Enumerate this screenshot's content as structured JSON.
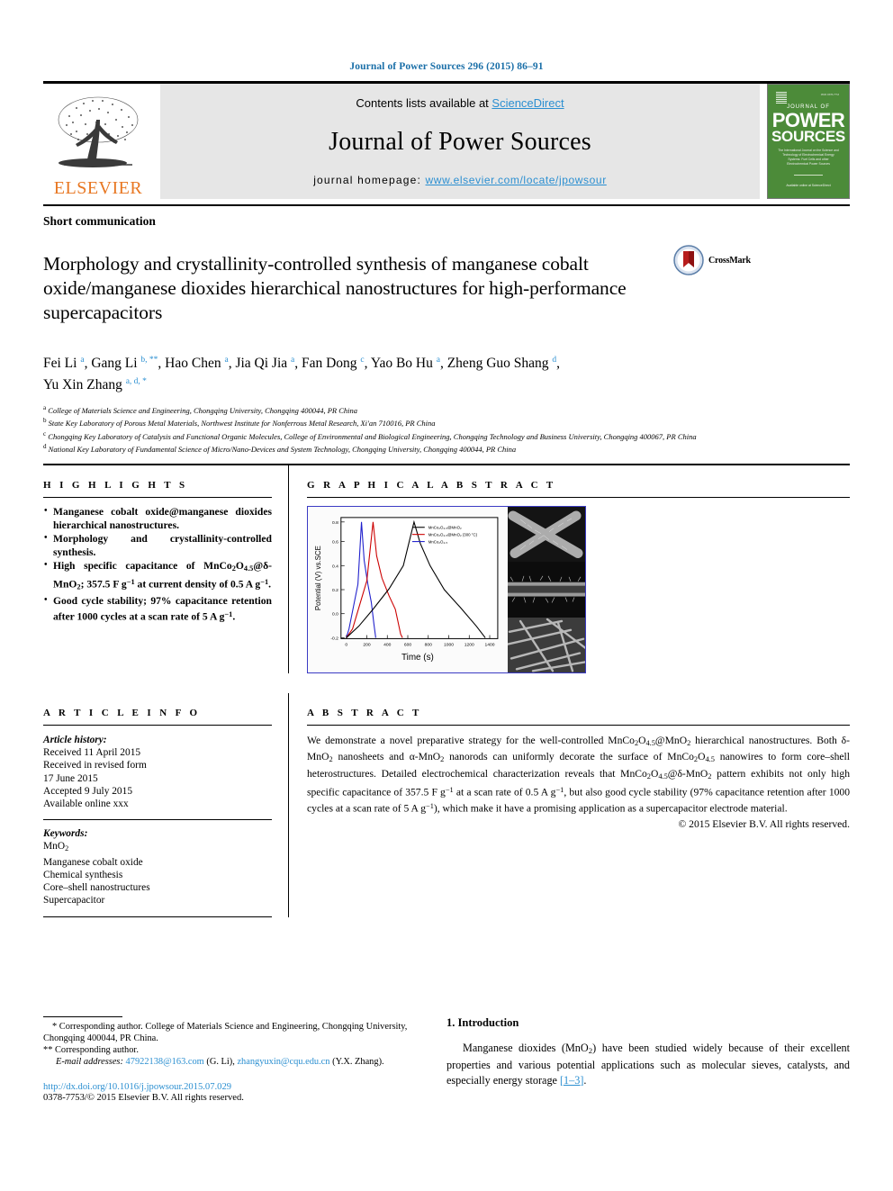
{
  "running_head": "Journal of Power Sources 296 (2015) 86–91",
  "masthead": {
    "contents_prefix": "Contents lists available at ",
    "sciencedirect": "ScienceDirect",
    "journal_title": "Journal of Power Sources",
    "homepage_prefix": "journal homepage: ",
    "homepage_url": "www.elsevier.com/locate/jpowsour",
    "publisher": "ELSEVIER",
    "cover": {
      "line_top": "ISSN 0378-7753",
      "journal_of": "JOURNAL OF",
      "power": "POWER",
      "sources": "SOURCES",
      "subtitle": "The International Journal on the Science and Technology of Electrochemical Energy Systems: Fuel Cells and other Electrochemical Power Sources",
      "footer": "Available online at\nScienceDirect"
    }
  },
  "article": {
    "doctype": "Short communication",
    "title": "Morphology and crystallinity-controlled synthesis of manganese cobalt oxide/manganese dioxides hierarchical nanostructures for high-performance supercapacitors",
    "crossmark_label": "CrossMark",
    "authors_line1": "Fei Li a, Gang Li b, **, Hao Chen a, Jia Qi Jia a, Fan Dong c, Yao Bo Hu a, Zheng Guo Shang d,",
    "authors_line2": "Yu Xin Zhang a, d, *",
    "affiliations": [
      {
        "mark": "a",
        "text": "College of Materials Science and Engineering, Chongqing University, Chongqing 400044, PR China"
      },
      {
        "mark": "b",
        "text": "State Key Laboratory of Porous Metal Materials, Northwest Institute for Nonferrous Metal Research, Xi'an 710016, PR China"
      },
      {
        "mark": "c",
        "text": "Chongqing Key Laboratory of Catalysis and Functional Organic Molecules, College of Environmental and Biological Engineering, Chongqing Technology and Business University, Chongqing 400067, PR China"
      },
      {
        "mark": "d",
        "text": "National Key Laboratory of Fundamental Science of Micro/Nano-Devices and System Technology, Chongqing University, Chongqing 400044, PR China"
      }
    ]
  },
  "highlights": {
    "heading": "H I G H L I G H T S",
    "items": [
      "Manganese cobalt oxide@manganese dioxides hierarchical nanostructures.",
      "Morphology and crystallinity-controlled synthesis.",
      "High specific capacitance of MnCo2O4.5@δ-MnO2; 357.5 F g−1 at current density of 0.5 A g−1.",
      "Good cycle stability; 97% capacitance retention after 1000 cycles at a scan rate of 5 A g−1."
    ]
  },
  "graphical_abstract": {
    "heading": "G R A P H I C A L   A B S T R A C T"
  },
  "chart_data": {
    "type": "line",
    "title": "",
    "xlabel": "Time (s)",
    "ylabel": "Potential (V) vs.SCE",
    "xlim": [
      -40,
      1500
    ],
    "ylim": [
      -0.22,
      0.92
    ],
    "xticks": [
      0,
      200,
      400,
      600,
      800,
      1000,
      1200,
      1400
    ],
    "yticks": [
      -0.2,
      0.0,
      0.2,
      0.4,
      0.6,
      0.8
    ],
    "grid": false,
    "legend_position": "upper-center",
    "series": [
      {
        "name": "MnCo2O4.5@MnO2",
        "color": "#000000",
        "x": [
          0,
          120,
          260,
          420,
          560,
          660,
          720,
          820,
          960,
          1120,
          1280,
          1370
        ],
        "y": [
          -0.2,
          -0.02,
          0.22,
          0.48,
          0.68,
          0.8,
          0.62,
          0.4,
          0.2,
          0.03,
          -0.12,
          -0.2
        ]
      },
      {
        "name": "MnCo2O4.5@MnO2 (300 °C)",
        "color": "#cc0000",
        "x": [
          0,
          60,
          130,
          200,
          262,
          300,
          350,
          420,
          480,
          530,
          548
        ],
        "y": [
          -0.2,
          -0.02,
          0.3,
          0.58,
          0.8,
          0.52,
          0.28,
          0.08,
          -0.06,
          -0.17,
          -0.2
        ]
      },
      {
        "name": "MnCo2O4.5",
        "color": "#2020cc",
        "x": [
          0,
          30,
          70,
          110,
          148,
          175,
          205,
          240,
          268,
          285
        ],
        "y": [
          -0.2,
          -0.06,
          0.26,
          0.56,
          0.8,
          0.48,
          0.22,
          0.02,
          -0.13,
          -0.2
        ]
      }
    ]
  },
  "article_info": {
    "heading": "A R T I C L E   I N F O",
    "history_label": "Article history:",
    "history": [
      "Received 11 April 2015",
      "Received in revised form",
      "17 June 2015",
      "Accepted 9 July 2015",
      "Available online xxx"
    ],
    "keywords_label": "Keywords:",
    "keywords": [
      "MnO2",
      "Manganese cobalt oxide",
      "Chemical synthesis",
      "Core–shell nanostructures",
      "Supercapacitor"
    ]
  },
  "abstract": {
    "heading": "A B S T R A C T",
    "body": "We demonstrate a novel preparative strategy for the well-controlled MnCo2O4.5@MnO2 hierarchical nanostructures. Both δ-MnO2 nanosheets and α-MnO2 nanorods can uniformly decorate the surface of MnCo2O4.5 nanowires to form core–shell heterostructures. Detailed electrochemical characterization reveals that MnCo2O4.5@δ-MnO2 pattern exhibits not only high specific capacitance of 357.5 F g−1 at a scan rate of 0.5 A g−1, but also good cycle stability (97% capacitance retention after 1000 cycles at a scan rate of 5 A g−1), which make it have a promising application as a supercapacitor electrode material.",
    "copyright": "© 2015 Elsevier B.V. All rights reserved."
  },
  "footnotes": {
    "corresponding_1": "* Corresponding author. College of Materials Science and Engineering, Chongqing University, Chongqing 400044, PR China.",
    "corresponding_2": "** Corresponding author.",
    "email_label": "E-mail addresses:",
    "email_1": "47922138@163.com",
    "email_1_owner": "(G. Li),",
    "email_2": "zhangyuxin@cqu.edu.cn",
    "email_2_owner": "(Y.X. Zhang).",
    "doi": "http://dx.doi.org/10.1016/j.jpowsour.2015.07.029",
    "issn": "0378-7753/© 2015 Elsevier B.V. All rights reserved."
  },
  "introduction": {
    "heading": "1. Introduction",
    "paragraph_pre": "Manganese dioxides (MnO2) have been studied widely because of their excellent properties and various potential applications such as molecular sieves, catalysts, and especially energy storage ",
    "reference": "[1–3]",
    "paragraph_post": "."
  },
  "colors": {
    "link": "#2b8fd1",
    "elsevier_orange": "#E87722",
    "cover_green": "#4c8b39",
    "ga_border": "#3b3bc4",
    "series_black": "#000000",
    "series_red": "#cc0000",
    "series_blue": "#2020cc"
  }
}
